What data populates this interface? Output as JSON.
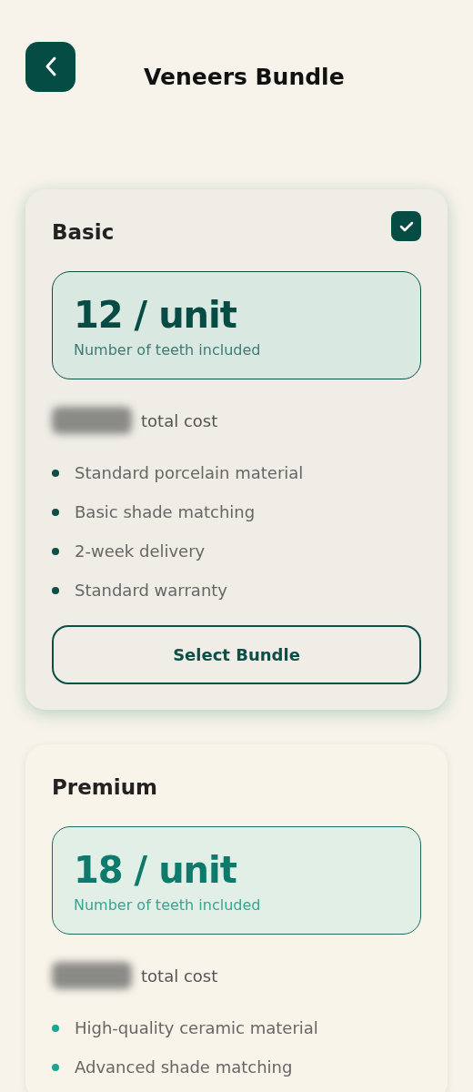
{
  "header": {
    "title": "Veneers Bundle"
  },
  "bundles": [
    {
      "name": "Basic",
      "selected": true,
      "units": "12 / unit",
      "units_caption": "Number of teeth included",
      "cost_label": "total cost",
      "features": [
        "Standard porcelain material",
        "Basic shade matching",
        "2-week delivery",
        "Standard warranty"
      ],
      "button": "Select Bundle"
    },
    {
      "name": "Premium",
      "selected": false,
      "units": "18 / unit",
      "units_caption": "Number of teeth included",
      "cost_label": "total cost",
      "features": [
        "High-quality ceramic material",
        "Advanced shade matching"
      ]
    }
  ]
}
